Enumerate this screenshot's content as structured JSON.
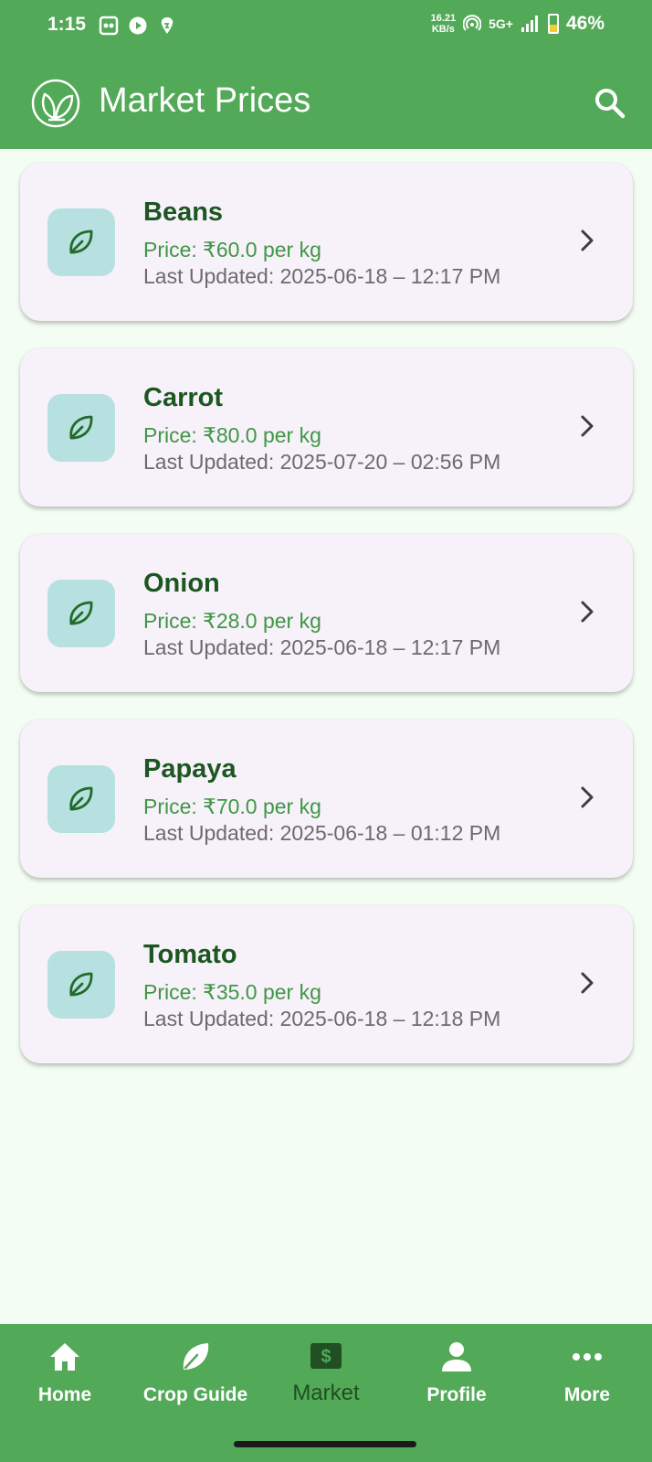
{
  "status_bar": {
    "time": "1:15",
    "net_speed_value": "16.21",
    "net_speed_unit": "KB/s",
    "network": "5G+",
    "battery": "46%"
  },
  "app_bar": {
    "title": "Market Prices",
    "logo_icon": "leaf-circle-icon",
    "search_icon": "search-icon"
  },
  "crops": [
    {
      "name": "Beans",
      "price": "Price: ₹60.0 per kg",
      "updated": "Last Updated: 2025-06-18 – 12:17 PM"
    },
    {
      "name": "Carrot",
      "price": "Price: ₹80.0 per kg",
      "updated": "Last Updated: 2025-07-20 – 02:56 PM"
    },
    {
      "name": "Onion",
      "price": "Price: ₹28.0 per kg",
      "updated": "Last Updated: 2025-06-18 – 12:17 PM"
    },
    {
      "name": "Papaya",
      "price": "Price: ₹70.0 per kg",
      "updated": "Last Updated: 2025-06-18 – 01:12 PM"
    },
    {
      "name": "Tomato",
      "price": "Price: ₹35.0 per kg",
      "updated": "Last Updated: 2025-06-18 – 12:18 PM"
    }
  ],
  "bottom_nav": {
    "items": [
      {
        "label": "Home",
        "icon": "home-icon"
      },
      {
        "label": "Crop Guide",
        "icon": "leaf-icon"
      },
      {
        "label": "Market",
        "icon": "dollar-sign-icon",
        "active": true
      },
      {
        "label": "Profile",
        "icon": "person-icon"
      },
      {
        "label": "More",
        "icon": "more-dots-icon"
      }
    ]
  },
  "colors": {
    "primary": "#52a957",
    "background": "#f3fdf3",
    "card": "#f7f1fa",
    "icon_box": "#b6e1e0",
    "crop_name": "#1c5620",
    "price": "#3f9744",
    "secondary_text": "#6b6b6e"
  }
}
